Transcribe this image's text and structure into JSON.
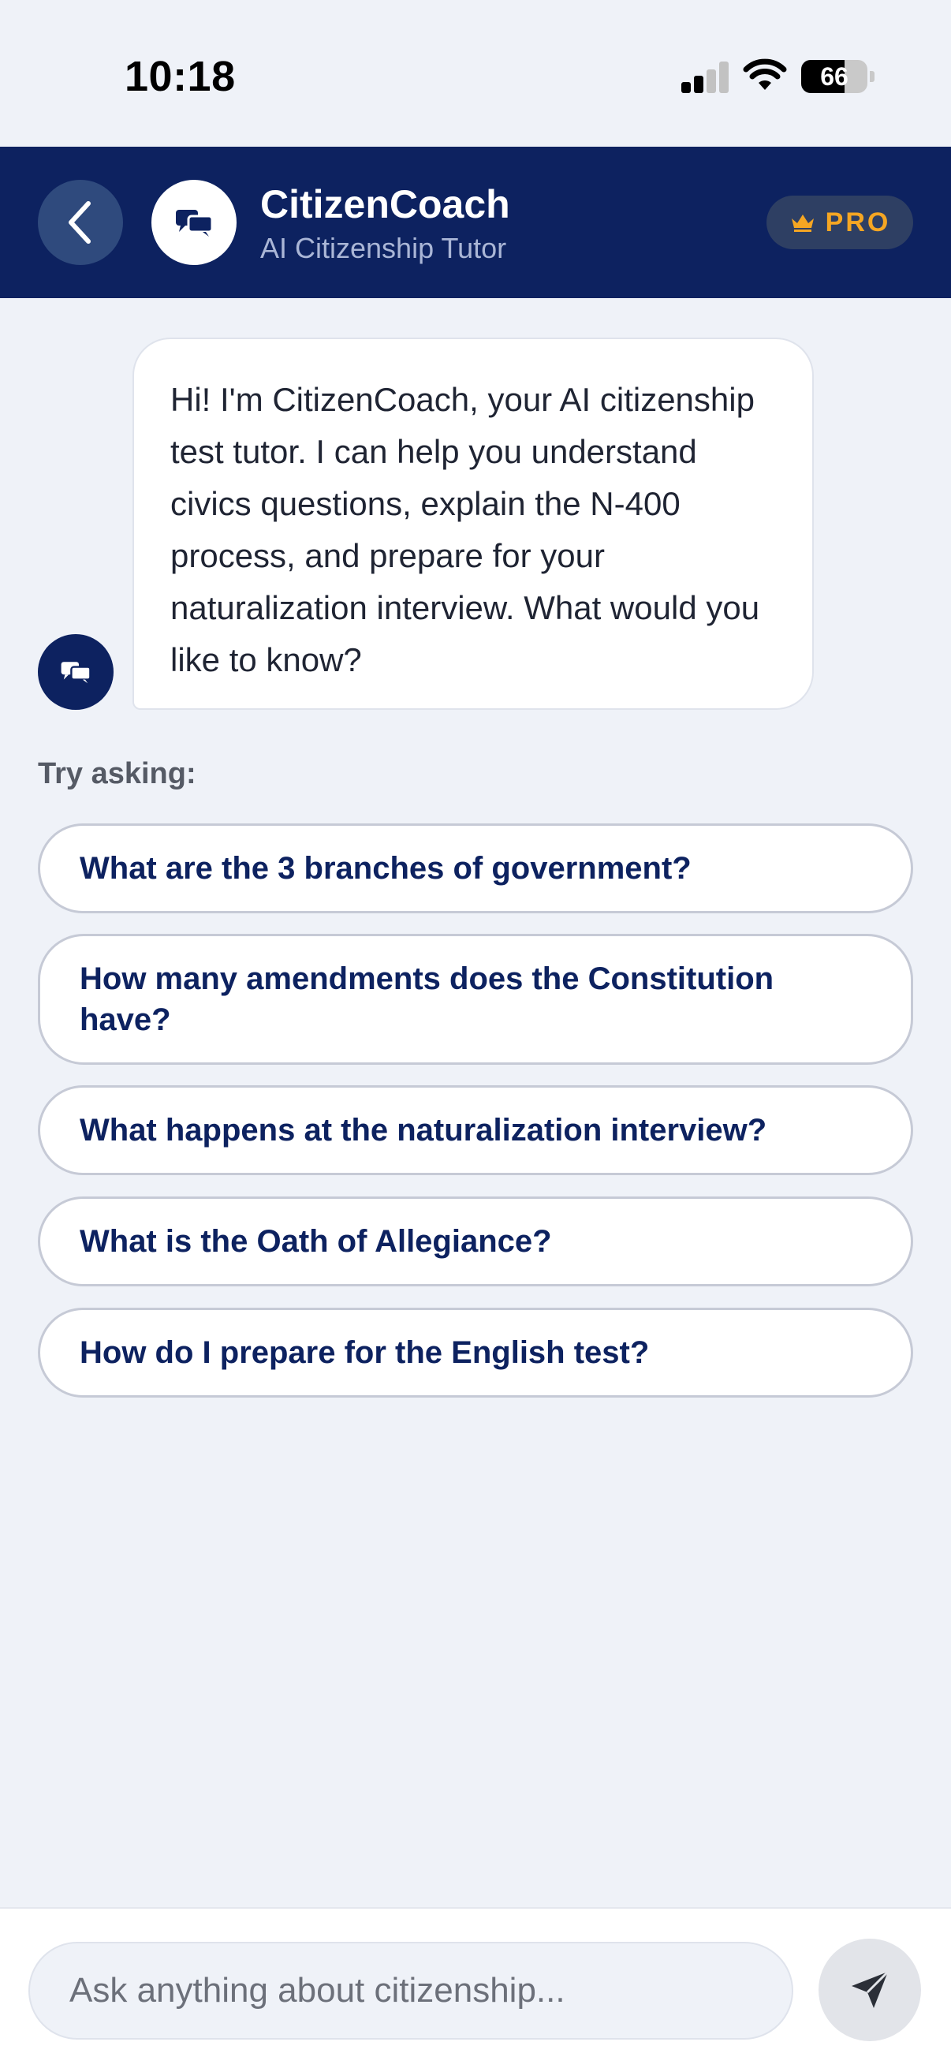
{
  "status_bar": {
    "time": "10:18",
    "battery": "66",
    "battery_level": 0.66
  },
  "header": {
    "title": "CitizenCoach",
    "subtitle": "AI Citizenship Tutor",
    "badge": "PRO"
  },
  "chat": {
    "messages": [
      {
        "sender": "bot",
        "text": "Hi! I'm CitizenCoach, your AI citizenship test tutor. I can help you understand civics questions, explain the N-400 process, and prepare for your naturalization interview. What would you like to know?"
      }
    ]
  },
  "suggestions": {
    "label": "Try asking:",
    "items": [
      "What are the 3 branches of government?",
      "How many amendments does the Constitution have?",
      "What happens at the naturalization interview?",
      "What is the Oath of Allegiance?",
      "How do I prepare for the English test?"
    ]
  },
  "input": {
    "placeholder": "Ask anything about citizenship...",
    "value": ""
  },
  "colors": {
    "brand": "#0d2260",
    "accent": "#f5a623",
    "background": "#eff2f8"
  },
  "icons": {
    "back": "chevron-left-icon",
    "logo": "chat-bubbles-icon",
    "badge": "crown-icon",
    "send": "paper-plane-icon"
  }
}
